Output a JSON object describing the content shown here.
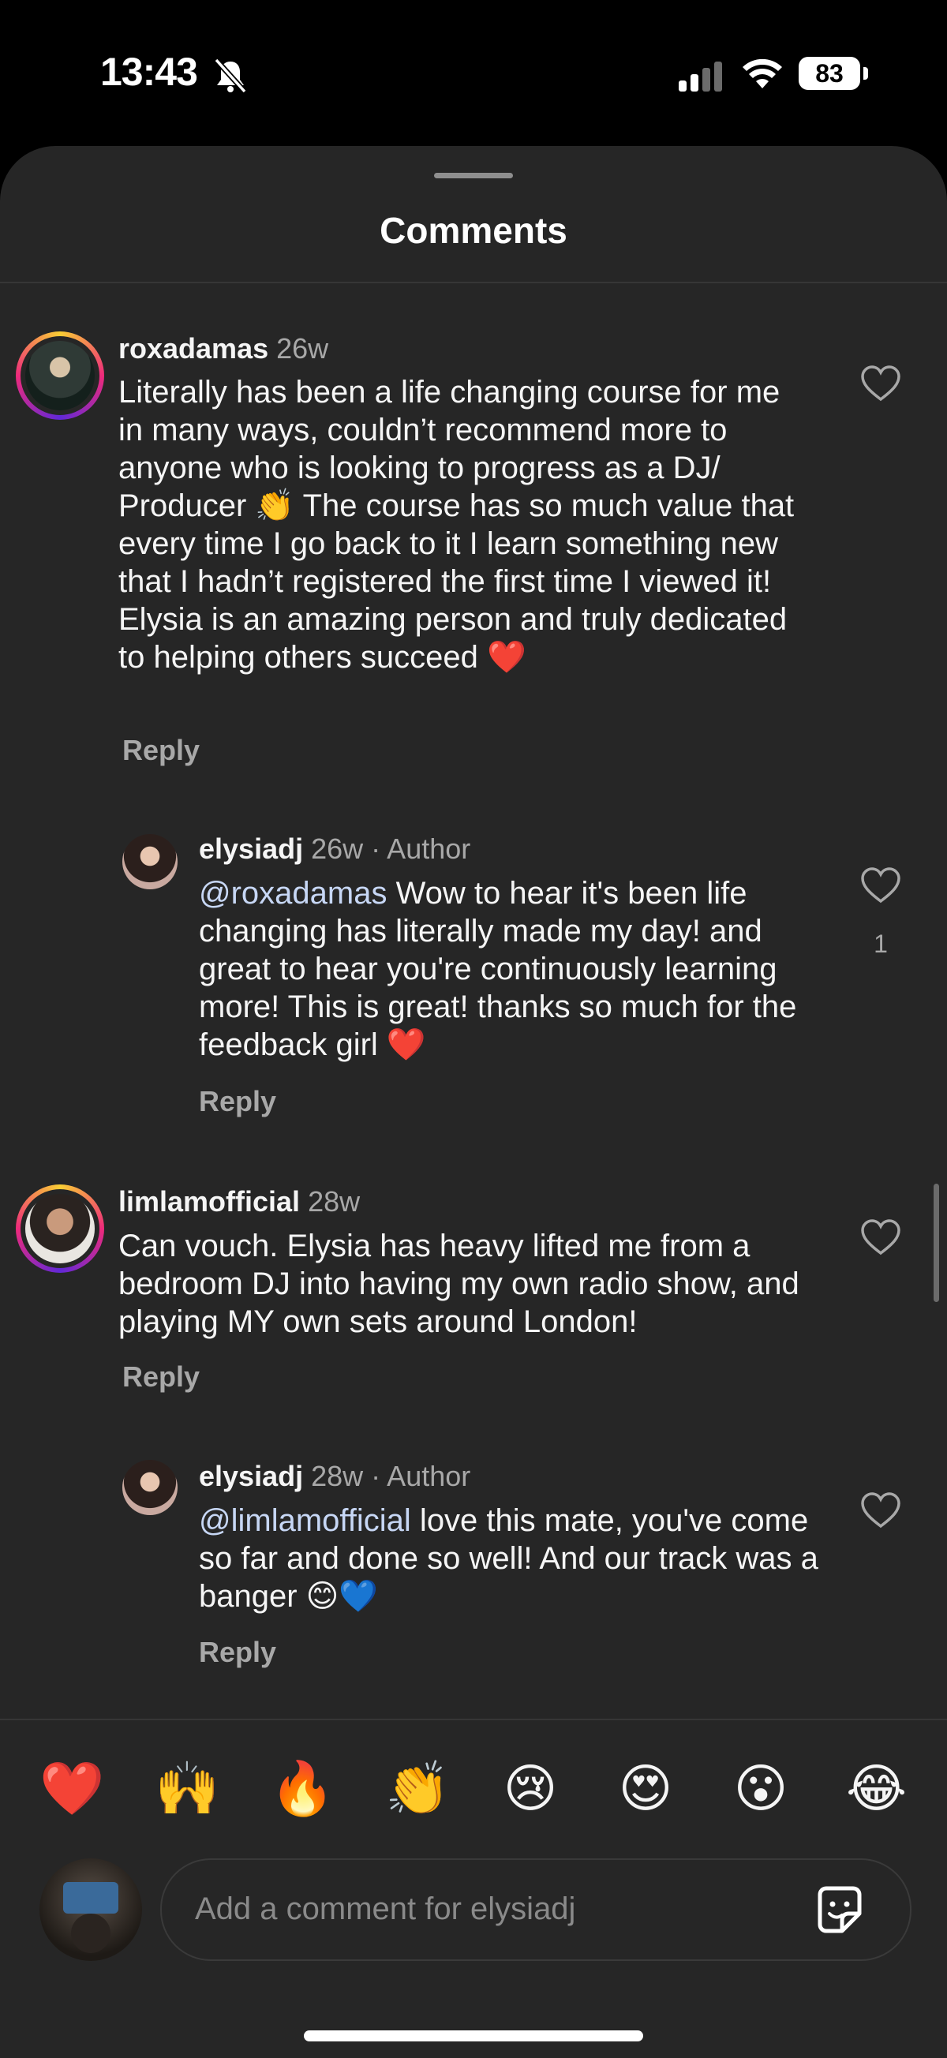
{
  "status_bar": {
    "time": "13:43",
    "battery": "83",
    "silent_icon": "bell-slash-icon"
  },
  "sheet": {
    "title": "Comments"
  },
  "comments": [
    {
      "username": "roxadamas",
      "age": "26w",
      "text": "Literally has been a life changing course for me in many ways, couldn’t recommend more to anyone who is looking to progress as a DJ/ Producer 👏 The course has so much value that every time I go back to it I learn something new that I hadn’t registered the first time I viewed it! Elysia is an amazing person and truly dedicated to helping others succeed ❤️",
      "reply_label": "Reply"
    },
    {
      "username": "elysiadj",
      "age": "26w",
      "author_tag": "· Author",
      "mention": "@roxadamas",
      "text": " Wow to hear it's been life changing has literally made my day! and great to hear you're continuously learning more! This is great! thanks so much for the feedback girl ❤️",
      "reply_label": "Reply",
      "likes": "1"
    },
    {
      "username": "limlamofficial",
      "age": "28w",
      "text": "Can vouch. Elysia has heavy lifted me from a bedroom DJ into having my own radio show, and playing MY own sets around London!",
      "reply_label": "Reply"
    },
    {
      "username": "elysiadj",
      "age": "28w",
      "author_tag": "· Author",
      "mention": "@limlamofficial",
      "text": " love this mate, you've come so far and done so well! And our track was a banger 😊💙",
      "reply_label": "Reply"
    }
  ],
  "reactions": [
    "❤️",
    "🙌",
    "🔥",
    "👏",
    "😢",
    "😍",
    "😮",
    "😂"
  ],
  "composer": {
    "placeholder": "Add a comment for elysiadj"
  }
}
